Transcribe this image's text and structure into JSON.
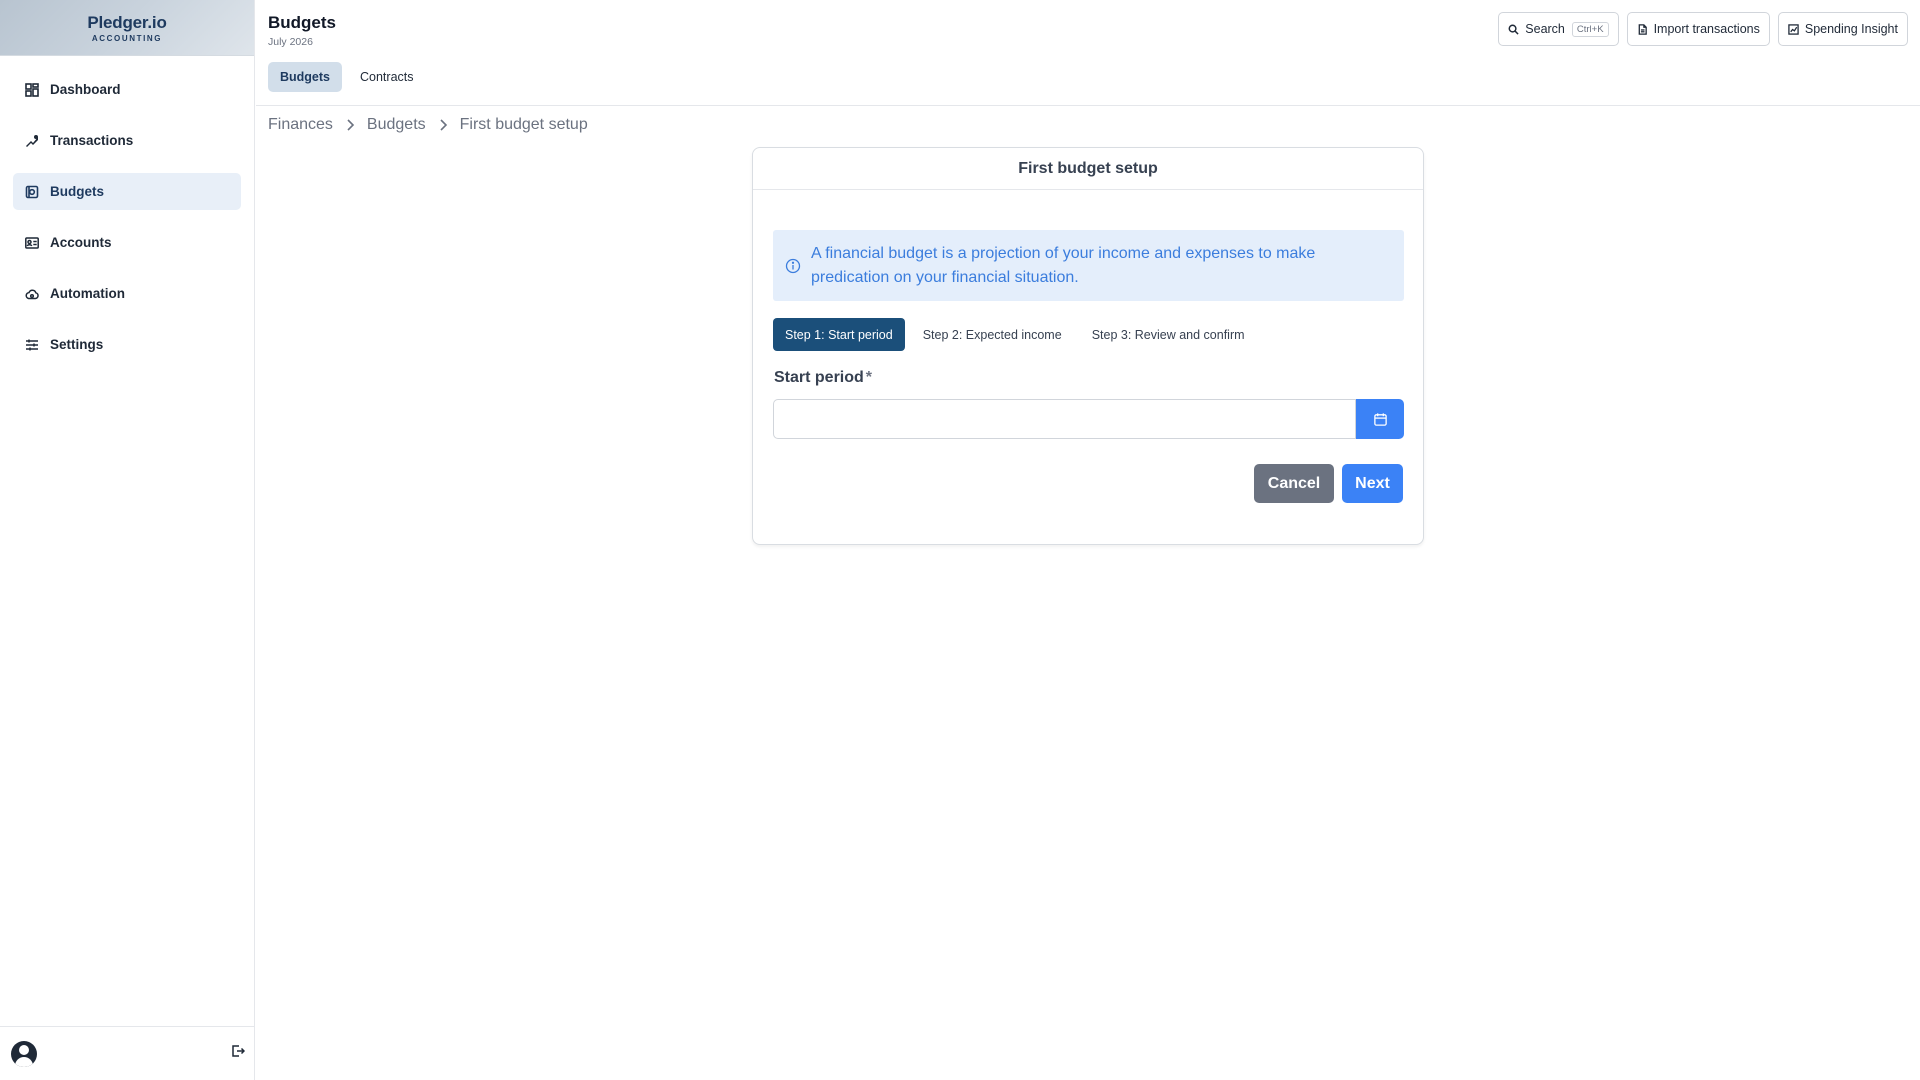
{
  "brand": {
    "name": "Pledger.io",
    "sub": "ACCOUNTING"
  },
  "sidebar": {
    "items": [
      {
        "label": "Dashboard",
        "icon": "dashboard-icon",
        "active": false
      },
      {
        "label": "Transactions",
        "icon": "transactions-icon",
        "active": false
      },
      {
        "label": "Budgets",
        "icon": "budgets-icon",
        "active": true
      },
      {
        "label": "Accounts",
        "icon": "accounts-icon",
        "active": false
      },
      {
        "label": "Automation",
        "icon": "automation-icon",
        "active": false
      },
      {
        "label": "Settings",
        "icon": "settings-icon",
        "active": false
      }
    ]
  },
  "header": {
    "title": "Budgets",
    "subtitle": "July 2026",
    "tabs": [
      {
        "label": "Budgets",
        "active": true
      },
      {
        "label": "Contracts",
        "active": false
      }
    ],
    "actions": {
      "search_label": "Search",
      "search_shortcut": "Ctrl+K",
      "import_label": "Import transactions",
      "insight_label": "Spending Insight"
    }
  },
  "breadcrumb": [
    "Finances",
    "Budgets",
    "First budget setup"
  ],
  "card": {
    "title": "First budget setup",
    "info": "A financial budget is a projection of your income and expenses to make predication on your financial situation.",
    "steps": [
      {
        "label": "Step 1: Start period",
        "active": true
      },
      {
        "label": "Step 2: Expected income",
        "active": false
      },
      {
        "label": "Step 3: Review and confirm",
        "active": false
      }
    ],
    "field": {
      "label": "Start period",
      "required_mark": "*",
      "value": ""
    },
    "cancel_label": "Cancel",
    "next_label": "Next"
  },
  "colors": {
    "primary": "#3b82f6",
    "active_step": "#1b4f7a",
    "info_bg": "#e4eefb",
    "info_text": "#3b7ddd",
    "cancel": "#6b7280"
  }
}
